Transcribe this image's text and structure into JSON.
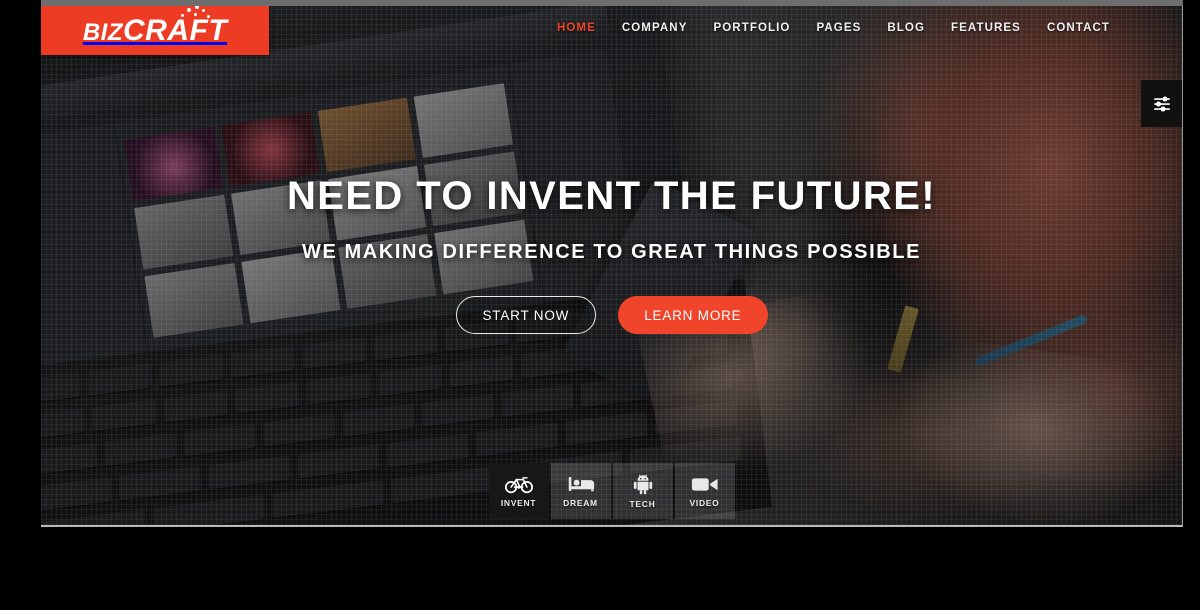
{
  "browser": {
    "chrome_top_name": "browser-top-bar"
  },
  "header": {
    "logo": {
      "part1": "BIZ",
      "part2": "CRAFT",
      "background_color": "#ee3b24",
      "dots_icon": "dots-decoration"
    },
    "nav_items": [
      {
        "label": "HOME",
        "active": true
      },
      {
        "label": "COMPANY",
        "active": false
      },
      {
        "label": "PORTFOLIO",
        "active": false
      },
      {
        "label": "PAGES",
        "active": false
      },
      {
        "label": "BLOG",
        "active": false
      },
      {
        "label": "FEATURES",
        "active": false
      },
      {
        "label": "CONTACT",
        "active": false
      }
    ],
    "active_color": "#f0452b",
    "link_color": "#f2f2f2"
  },
  "settings_panel": {
    "icon": "sliders-icon",
    "background_color": "#111111"
  },
  "hero": {
    "heading": "NEED TO INVENT THE FUTURE!",
    "subheading": "WE MAKING DIFFERENCE TO GREAT THINGS POSSIBLE",
    "buttons": {
      "primary": {
        "label": "LEARN MORE",
        "color": "#f0452b",
        "style": "solid"
      },
      "secondary": {
        "label": "START NOW",
        "color": "#ffffff",
        "style": "outline"
      }
    }
  },
  "tabstrip": {
    "tabs": [
      {
        "label": "INVENT",
        "icon": "bicycle-icon",
        "active": true
      },
      {
        "label": "DREAM",
        "icon": "bed-icon",
        "active": false
      },
      {
        "label": "TECH",
        "icon": "android-icon",
        "active": false
      },
      {
        "label": "VIDEO",
        "icon": "video-camera-icon",
        "active": false
      }
    ],
    "active_background": "#171717"
  }
}
